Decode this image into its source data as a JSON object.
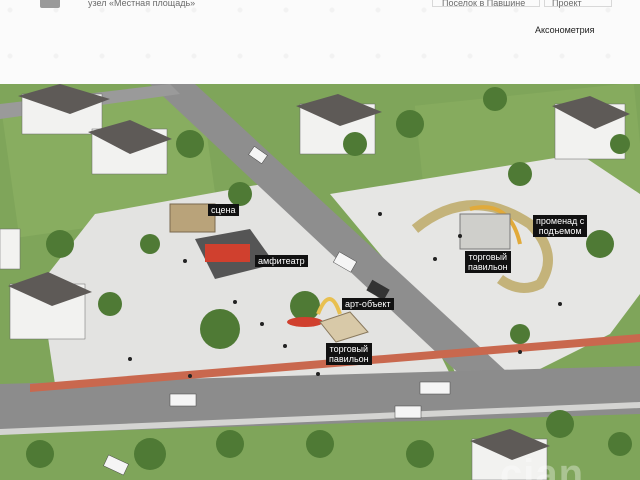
{
  "header": {
    "breadcrumbs": [
      "узел «Местная площадь»",
      "Поселок в Павшине",
      "Проект"
    ],
    "view_title": "Аксонометрия"
  },
  "labels": {
    "stage": "сцена",
    "amphitheater": "амфитеатр",
    "art_object": "арт-объект",
    "pavilion_1": "торговый\nпавильон",
    "pavilion_2": "торговый\nпавильон",
    "promenade": "променад с\nподъемом"
  },
  "watermark": "cian",
  "colors": {
    "grass": "#7fa55a",
    "plaza": "#e4e4e2",
    "road": "#8a8a8a",
    "path": "#c9684e"
  }
}
